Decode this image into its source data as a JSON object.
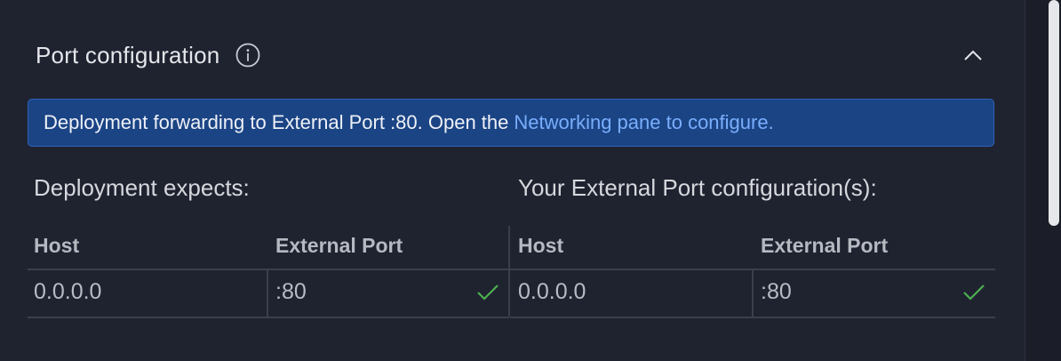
{
  "section": {
    "title": "Port configuration"
  },
  "banner": {
    "text": "Deployment forwarding to External Port :80. Open the",
    "link": "Networking pane to configure."
  },
  "expects": {
    "label": "Deployment expects:",
    "columns": [
      "Host",
      "External Port"
    ],
    "rows": [
      {
        "host": "0.0.0.0",
        "port": ":80",
        "status": "check-icon"
      }
    ]
  },
  "external": {
    "label": "Your External Port configuration(s):",
    "columns": [
      "Host",
      "External Port"
    ],
    "rows": [
      {
        "host": "0.0.0.0",
        "port": ":80",
        "status": "check-icon"
      }
    ]
  },
  "colors": {
    "background": "#1f2330",
    "banner": "#1b4485",
    "link": "#79aefc",
    "success": "#4caf50"
  }
}
